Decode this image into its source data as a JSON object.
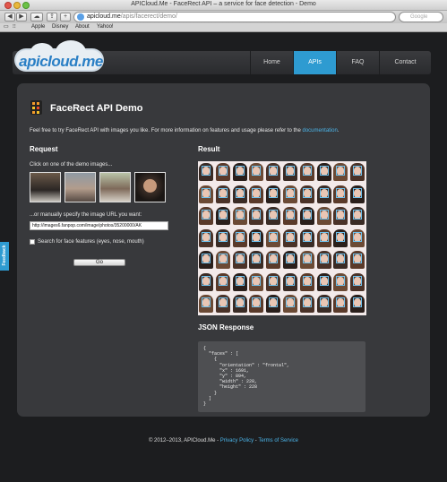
{
  "window": {
    "title": "APICloud.Me - FaceRect API – a service for face detection - Demo"
  },
  "browser": {
    "url_host": "apicloud.me",
    "url_path": "/apis/facerect/demo/",
    "search_placeholder": "Google",
    "bookmarks": [
      "Apple",
      "Disney",
      "About",
      "Yahoo!"
    ]
  },
  "site": {
    "logo": "apicloud.me",
    "nav": [
      "Home",
      "APIs",
      "FAQ",
      "Contact"
    ],
    "active_nav": "APIs"
  },
  "main": {
    "title": "FaceRect API Demo",
    "intro_text": "Feel free to try FaceRect API with images you like. For more information on features and usage please refer to the",
    "intro_link": "documentation",
    "intro_end": "."
  },
  "request": {
    "heading": "Request",
    "demo_prompt": "Click on one of the demo images...",
    "manual_prompt": "...or manually specify the image URL you want:",
    "url_value": "http://images6.fanpop.com/image/photos/35200000/AK",
    "checkbox_label": "Search for face features (eyes, nose, mouth)",
    "go_label": "Go"
  },
  "result": {
    "heading": "Result",
    "json_heading": "JSON Response",
    "json_text": "{\n  \"faces\" : [\n    {\n      \"orientation\" : \"frontal\",\n      \"x\" : 1691,\n      \"y\" : 894,\n      \"width\" : 228,\n      \"height\" : 228\n    }\n  ]\n}"
  },
  "footer": {
    "copyright": "© 2012–2013, APICloud.Me - ",
    "privacy": "Privacy Policy",
    "sep": " - ",
    "terms": "Terms of Service"
  },
  "feedback_tab": "Feedback",
  "colors": {
    "accent": "#2e9bd1",
    "link": "#4bb4e8",
    "panel": "#38393c",
    "background": "#1c1d1f"
  }
}
